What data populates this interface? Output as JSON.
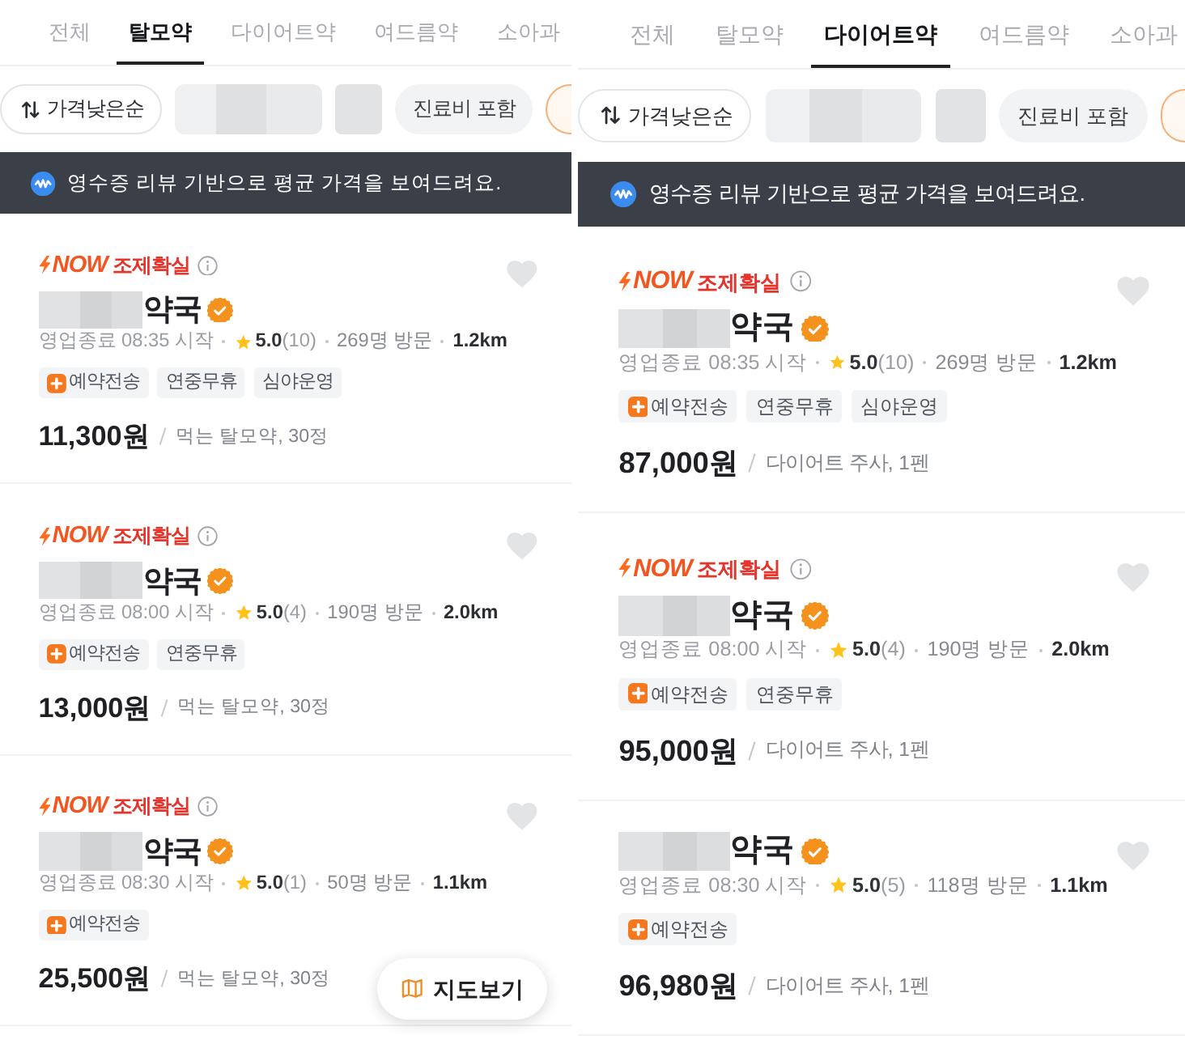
{
  "screens": [
    {
      "tabs": [
        {
          "label": "전체",
          "selected": false
        },
        {
          "label": "탈모약",
          "selected": true
        },
        {
          "label": "다이어트약",
          "selected": false
        },
        {
          "label": "여드름약",
          "selected": false
        },
        {
          "label": "소아과",
          "selected": false
        }
      ],
      "filters": [
        {
          "kind": "sort",
          "label": "가격낮은순"
        },
        {
          "kind": "redacted"
        },
        {
          "kind": "redacted"
        },
        {
          "kind": "chip",
          "label": "진료비 포함"
        },
        {
          "kind": "cut"
        }
      ],
      "notice": "영수증 리뷰 기반으로 평균 가격을 보여드려요.",
      "pharmacies": [
        {
          "now_badge": {
            "text": "NOW",
            "label": "조제확실"
          },
          "name_redacted": true,
          "name": "약국",
          "verified": true,
          "hours": "영업종료 08:35 시작",
          "rating": "5.0",
          "reviews": "(10)",
          "visits": "269명 방문",
          "distance": "1.2km",
          "tags": [
            {
              "kind": "reservation",
              "label": "예약전송"
            },
            {
              "kind": "plain",
              "label": "연중무휴"
            },
            {
              "kind": "plain",
              "label": "심야운영"
            }
          ],
          "price": "11,300원",
          "unit": "먹는 탈모약, 30정",
          "favorite": false
        },
        {
          "now_badge": {
            "text": "NOW",
            "label": "조제확실"
          },
          "name_redacted": true,
          "name": "약국",
          "verified": true,
          "hours": "영업종료 08:00 시작",
          "rating": "5.0",
          "reviews": "(4)",
          "visits": "190명 방문",
          "distance": "2.0km",
          "tags": [
            {
              "kind": "reservation",
              "label": "예약전송"
            },
            {
              "kind": "plain",
              "label": "연중무휴"
            }
          ],
          "price": "13,000원",
          "unit": "먹는 탈모약, 30정",
          "favorite": false
        },
        {
          "now_badge": {
            "text": "NOW",
            "label": "조제확실"
          },
          "name_redacted": true,
          "name": "약국",
          "verified": true,
          "hours": "영업종료 08:30 시작",
          "rating": "5.0",
          "reviews": "(1)",
          "visits": "50명 방문",
          "distance": "1.1km",
          "tags": [
            {
              "kind": "reservation",
              "label": "예약전송"
            }
          ],
          "price": "25,500원",
          "unit": "먹는 탈모약, 30정",
          "favorite": false
        }
      ],
      "map_button": {
        "label": "지도보기"
      }
    },
    {
      "tabs": [
        {
          "label": "전체",
          "selected": false
        },
        {
          "label": "탈모약",
          "selected": false
        },
        {
          "label": "다이어트약",
          "selected": true
        },
        {
          "label": "여드름약",
          "selected": false
        },
        {
          "label": "소아과",
          "selected": false
        }
      ],
      "filters": [
        {
          "kind": "sort",
          "label": "가격낮은순"
        },
        {
          "kind": "redacted"
        },
        {
          "kind": "redacted"
        },
        {
          "kind": "chip",
          "label": "진료비 포함"
        },
        {
          "kind": "cut"
        }
      ],
      "notice": "영수증 리뷰 기반으로 평균 가격을 보여드려요.",
      "pharmacies": [
        {
          "now_badge": {
            "text": "NOW",
            "label": "조제확실"
          },
          "name_redacted": true,
          "name": "약국",
          "verified": true,
          "hours": "영업종료 08:35 시작",
          "rating": "5.0",
          "reviews": "(10)",
          "visits": "269명 방문",
          "distance": "1.2km",
          "tags": [
            {
              "kind": "reservation",
              "label": "예약전송"
            },
            {
              "kind": "plain",
              "label": "연중무휴"
            },
            {
              "kind": "plain",
              "label": "심야운영"
            }
          ],
          "price": "87,000원",
          "unit": "다이어트 주사, 1펜",
          "favorite": false
        },
        {
          "now_badge": {
            "text": "NOW",
            "label": "조제확실"
          },
          "name_redacted": true,
          "name": "약국",
          "verified": true,
          "hours": "영업종료 08:00 시작",
          "rating": "5.0",
          "reviews": "(4)",
          "visits": "190명 방문",
          "distance": "2.0km",
          "tags": [
            {
              "kind": "reservation",
              "label": "예약전송"
            },
            {
              "kind": "plain",
              "label": "연중무휴"
            }
          ],
          "price": "95,000원",
          "unit": "다이어트 주사, 1펜",
          "favorite": false
        },
        {
          "name_redacted": true,
          "name": "약국",
          "verified": true,
          "hours": "영업종료 08:30 시작",
          "rating": "5.0",
          "reviews": "(5)",
          "visits": "118명 방문",
          "distance": "1.1km",
          "tags": [
            {
              "kind": "reservation",
              "label": "예약전송"
            }
          ],
          "price": "96,980원",
          "unit": "다이어트 주사, 1펜",
          "favorite": false
        }
      ]
    }
  ]
}
